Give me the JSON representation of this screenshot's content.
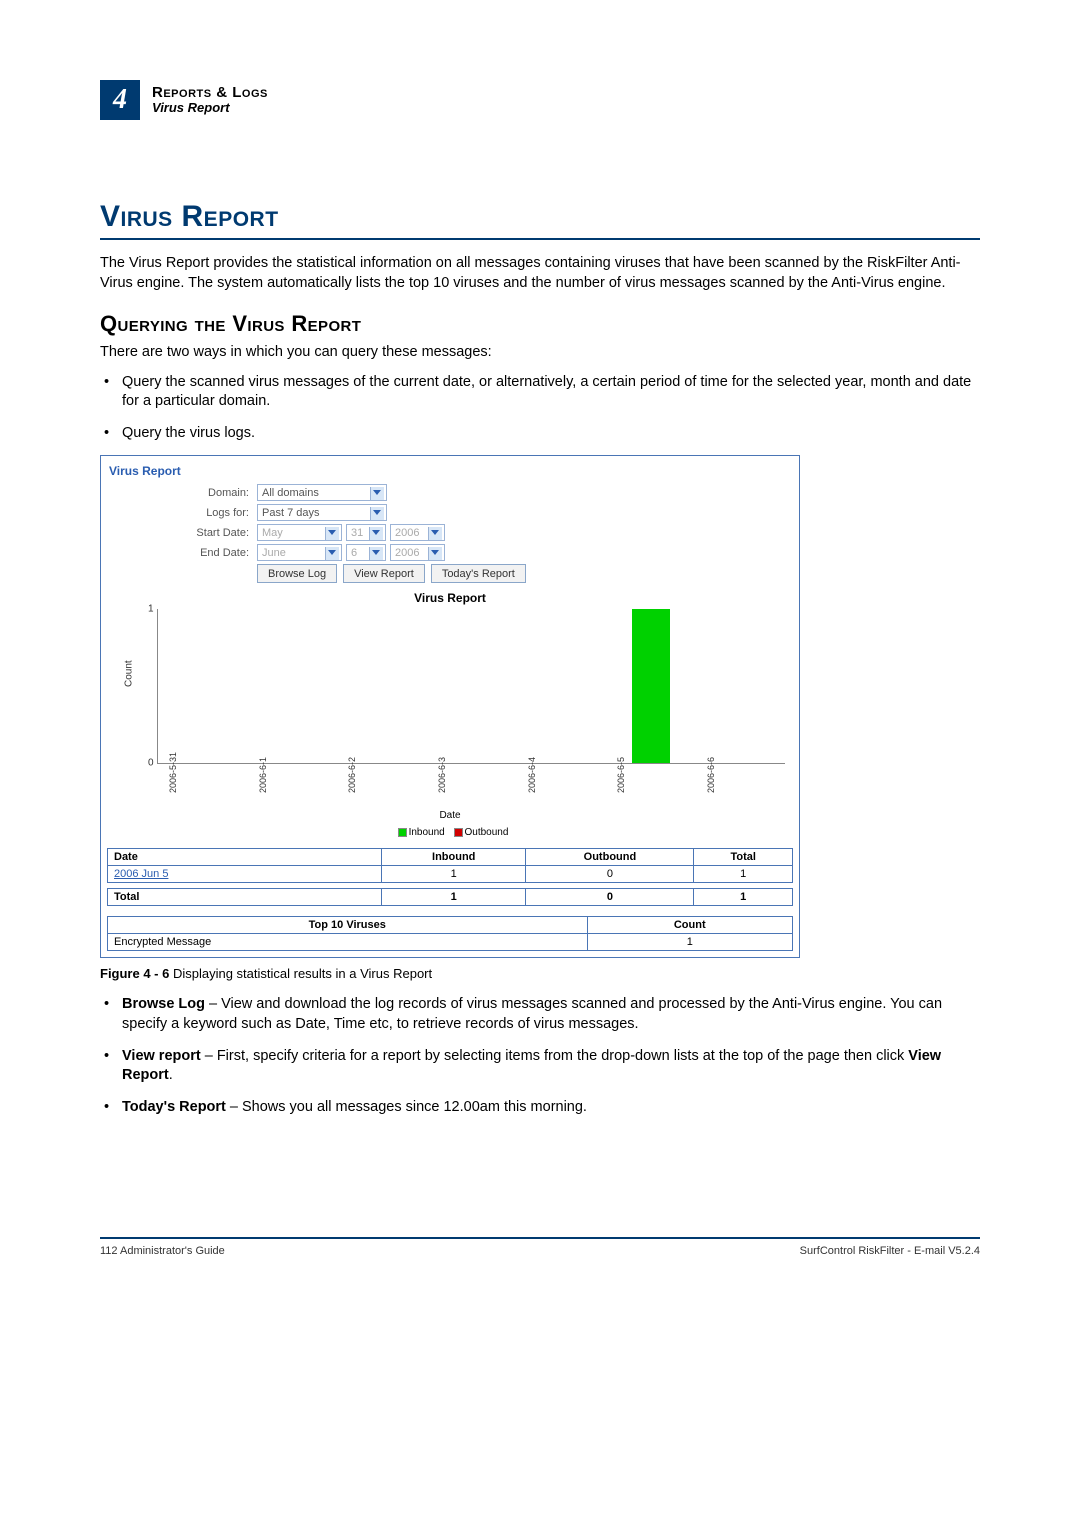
{
  "chapter": {
    "num": "4",
    "title": "Reports & Logs",
    "sub": "Virus Report"
  },
  "section_title": "Virus Report",
  "intro": "The Virus Report provides the statistical information on all messages containing viruses that have been scanned by the RiskFilter Anti-Virus engine. The system automatically lists the top 10 viruses and the number of virus messages scanned by the Anti-Virus engine.",
  "sub_title": "Querying the Virus Report",
  "sub_intro": "There are two ways in which you can query these messages:",
  "ways": [
    "Query the scanned virus messages of the current date, or alternatively, a certain period of time for the selected year, month and date for a particular domain.",
    "Query the virus logs."
  ],
  "figure": {
    "panel_title": "Virus Report",
    "form": {
      "domain_label": "Domain:",
      "domain_value": "All domains",
      "logs_label": "Logs for:",
      "logs_value": "Past 7 days",
      "start_label": "Start Date:",
      "start_month": "May",
      "start_day": "31",
      "start_year": "2006",
      "end_label": "End Date:",
      "end_month": "June",
      "end_day": "6",
      "end_year": "2006"
    },
    "buttons": {
      "browse": "Browse Log",
      "view": "View Report",
      "today": "Today's Report"
    },
    "chart_title": "Virus Report",
    "x_title": "Date",
    "legend": {
      "in": "Inbound",
      "out": "Outbound"
    },
    "summary": {
      "headers": {
        "date": "Date",
        "in": "Inbound",
        "out": "Outbound",
        "total": "Total"
      },
      "row": {
        "date": "2006 Jun 5",
        "in": "1",
        "out": "0",
        "total": "1"
      },
      "foot": {
        "label": "Total",
        "in": "1",
        "out": "0",
        "total": "1"
      }
    },
    "viruses": {
      "headers": {
        "name": "Top 10 Viruses",
        "count": "Count"
      },
      "row": {
        "name": "Encrypted Message",
        "count": "1"
      }
    },
    "caption_bold": "Figure 4 - 6",
    "caption_rest": " Displaying statistical results in a Virus Report"
  },
  "bullets2": [
    {
      "b": "Browse Log",
      "t": " – View and download the log records of virus messages scanned and processed by the Anti-Virus engine. You can specify a keyword such as Date, Time etc, to retrieve records of virus messages."
    },
    {
      "b": "View report",
      "t1": " – First, specify criteria for a report by selecting items from the drop-down lists at the top of the page then click ",
      "b2": "View Report",
      "t2": "."
    },
    {
      "b": "Today's Report",
      "t": " – Shows you all messages since 12.00am this morning."
    }
  ],
  "footer": {
    "left": "112  Administrator's Guide",
    "right": "SurfControl RiskFilter - E-mail V5.2.4"
  },
  "chart_data": {
    "type": "bar",
    "title": "Virus Report",
    "xlabel": "Date",
    "ylabel": "Count",
    "ylim": [
      0,
      1
    ],
    "categories": [
      "2006-5-31",
      "2006-6-1",
      "2006-6-2",
      "2006-6-3",
      "2006-6-4",
      "2006-6-5",
      "2006-6-6"
    ],
    "series": [
      {
        "name": "Inbound",
        "values": [
          0,
          0,
          0,
          0,
          0,
          1,
          0
        ]
      },
      {
        "name": "Outbound",
        "values": [
          0,
          0,
          0,
          0,
          0,
          0,
          0
        ]
      }
    ]
  }
}
